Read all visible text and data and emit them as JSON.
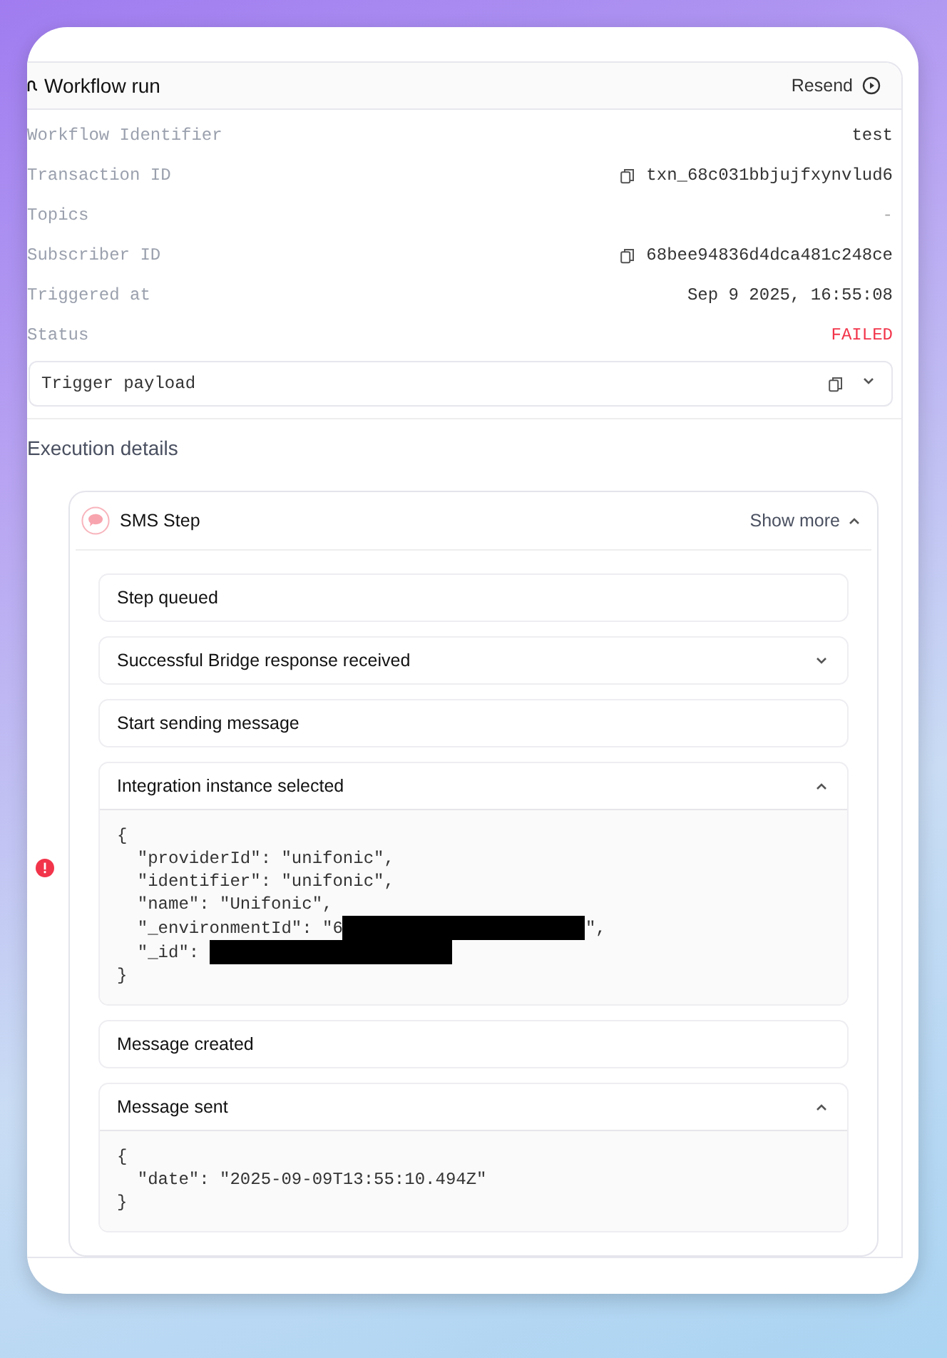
{
  "header": {
    "title": "Workflow run",
    "action": "Resend"
  },
  "fields": [
    {
      "label": "Workflow Identifier",
      "value": "test",
      "copyable": false,
      "kind": "plain"
    },
    {
      "label": "Transaction ID",
      "value": "txn_68c031bbjujfxynvlud6",
      "copyable": true,
      "kind": "plain"
    },
    {
      "label": "Topics",
      "value": "-",
      "copyable": false,
      "kind": "muted"
    },
    {
      "label": "Subscriber ID",
      "value": "68bee94836d4dca481c248ce",
      "copyable": true,
      "kind": "plain"
    },
    {
      "label": "Triggered at",
      "value": "Sep 9 2025, 16:55:08",
      "copyable": false,
      "kind": "plain"
    },
    {
      "label": "Status",
      "value": "FAILED",
      "copyable": false,
      "kind": "error"
    }
  ],
  "trigger_payload": {
    "label": "Trigger payload",
    "expanded": false
  },
  "execution": {
    "title": "Execution details",
    "step": {
      "name": "SMS Step",
      "toggle": "Show more",
      "expanded": true,
      "error": true,
      "events": [
        {
          "title": "Step queued",
          "expandable": false,
          "expanded": false
        },
        {
          "title": "Successful Bridge response received",
          "expandable": true,
          "expanded": false
        },
        {
          "title": "Start sending message",
          "expandable": false,
          "expanded": false
        },
        {
          "title": "Integration instance selected",
          "expandable": true,
          "expanded": true,
          "code": [
            [
              {
                "kind": "text",
                "text": "{"
              }
            ],
            [
              {
                "kind": "text",
                "text": "  \"providerId\": \"unifonic\","
              }
            ],
            [
              {
                "kind": "text",
                "text": "  \"identifier\": \"unifonic\","
              }
            ],
            [
              {
                "kind": "text",
                "text": "  \"name\": \"Unifonic\","
              }
            ],
            [
              {
                "kind": "text",
                "text": "  \"_environmentId\": \"6"
              },
              {
                "kind": "redaction"
              },
              {
                "kind": "text",
                "text": "\","
              }
            ],
            [
              {
                "kind": "text",
                "text": "  \"_id\": "
              },
              {
                "kind": "redaction"
              }
            ],
            [
              {
                "kind": "text",
                "text": "}"
              }
            ]
          ]
        },
        {
          "title": "Message created",
          "expandable": false,
          "expanded": false
        },
        {
          "title": "Message sent",
          "expandable": true,
          "expanded": true,
          "code": [
            [
              {
                "kind": "text",
                "text": "{"
              }
            ],
            [
              {
                "kind": "text",
                "text": "  \"date\": \"2025-09-09T13:55:10.494Z\""
              }
            ],
            [
              {
                "kind": "text",
                "text": "}"
              }
            ]
          ]
        }
      ]
    }
  }
}
